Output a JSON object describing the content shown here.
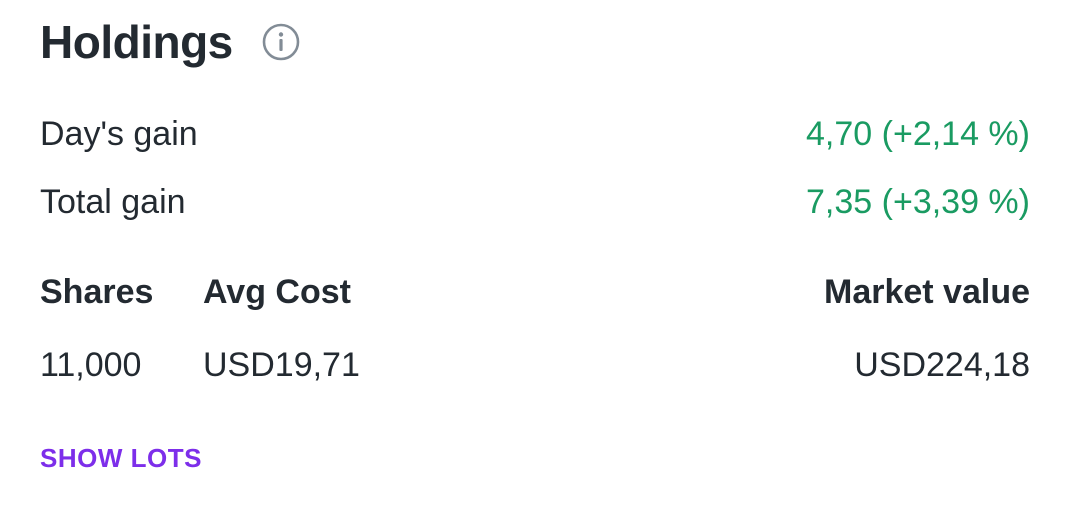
{
  "header": {
    "title": "Holdings",
    "info_icon": "info-icon"
  },
  "gains": {
    "day_label": "Day's gain",
    "day_value": "4,70 (+2,14 %)",
    "total_label": "Total gain",
    "total_value": "7,35 (+3,39 %)"
  },
  "stats": {
    "shares_label": "Shares",
    "avg_cost_label": "Avg Cost",
    "market_value_label": "Market value",
    "shares_value": "11,000",
    "avg_cost_value": "USD19,71",
    "market_value_value": "USD224,18"
  },
  "actions": {
    "show_lots_label": "SHOW LOTS"
  },
  "colors": {
    "text": "#232a31",
    "gain_positive": "#1a9b62",
    "accent": "#7d2eea",
    "icon": "#828c96"
  }
}
